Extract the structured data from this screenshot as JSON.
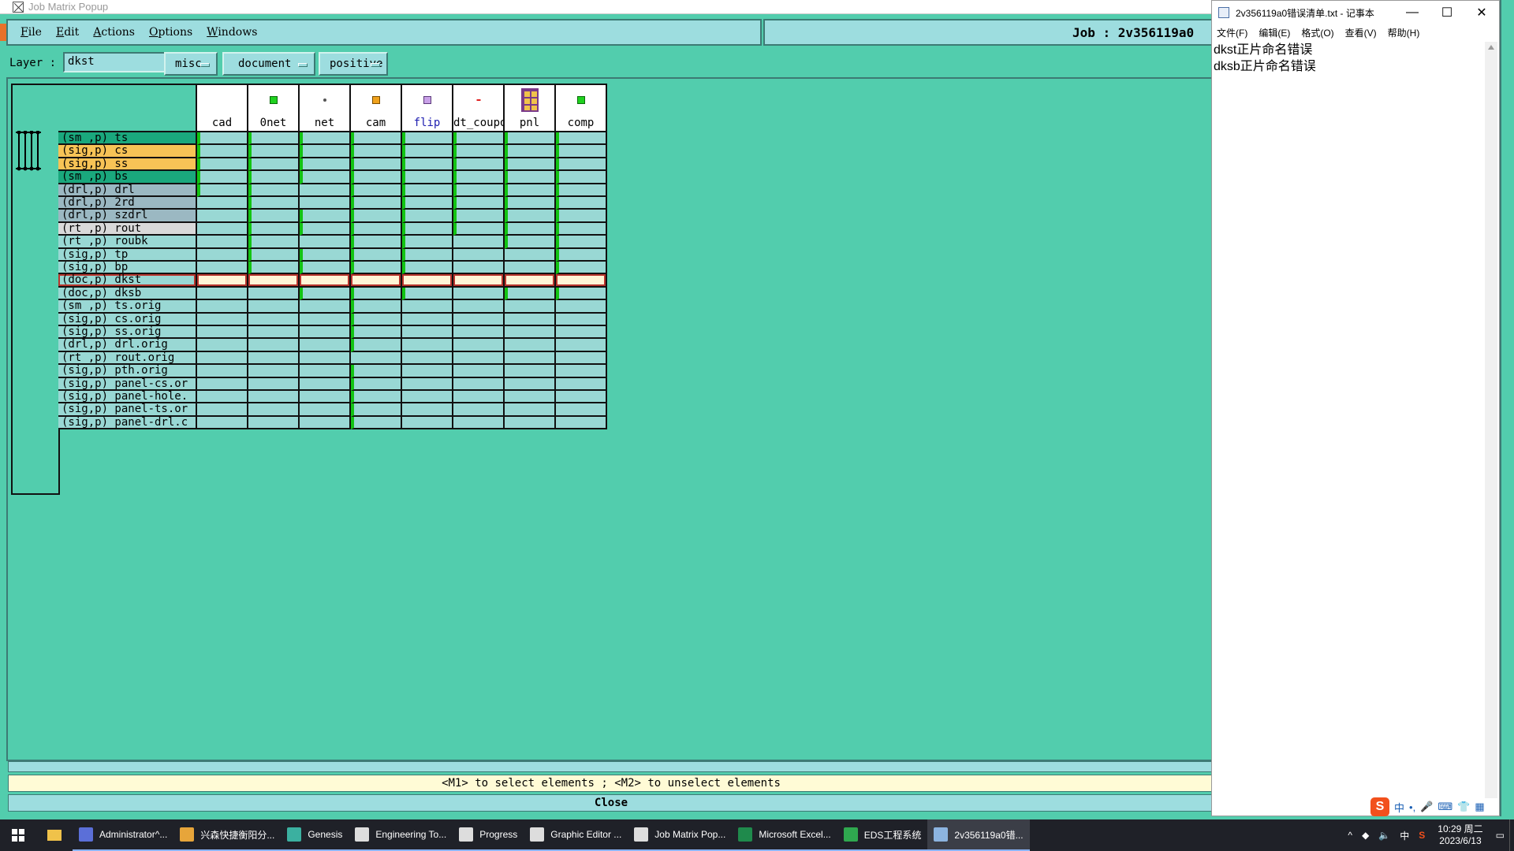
{
  "job_window": {
    "title": "Job Matrix Popup",
    "menus": [
      {
        "u": "F",
        "rest": "ile"
      },
      {
        "u": "E",
        "rest": "dit"
      },
      {
        "u": "A",
        "rest": "ctions"
      },
      {
        "u": "O",
        "rest": "ptions"
      },
      {
        "u": "W",
        "rest": "indows"
      }
    ],
    "job_label": "Job : 2v356119a0",
    "layer_label": "Layer :",
    "layer_value": "dkst",
    "combos": [
      "misc",
      "document",
      "positive"
    ],
    "columns": [
      {
        "label": "cad",
        "icon": "none",
        "color": "#000000"
      },
      {
        "label": "0net",
        "icon": "green-square",
        "color": "#000000"
      },
      {
        "label": "net",
        "icon": "dot",
        "color": "#000000"
      },
      {
        "label": "cam",
        "icon": "orange-square",
        "color": "#000000"
      },
      {
        "label": "flip",
        "icon": "purple-square",
        "color": "#1d1db0"
      },
      {
        "label": "dt_coupo",
        "icon": "red-dash",
        "color": "#000000"
      },
      {
        "label": "pnl",
        "icon": "panel-grid",
        "color": "#000000"
      },
      {
        "label": "comp",
        "icon": "green-square",
        "color": "#000000"
      }
    ],
    "rows": [
      {
        "label": "(sm ,p) ts",
        "bg": "#1aa87d"
      },
      {
        "label": "(sig,p) cs",
        "bg": "#f7c356"
      },
      {
        "label": "(sig,p) ss",
        "bg": "#f7c356"
      },
      {
        "label": "(sm ,p) bs",
        "bg": "#1aa87d"
      },
      {
        "label": "(drl,p) drl",
        "bg": "#9bb8c2"
      },
      {
        "label": "(drl,p) 2rd",
        "bg": "#9bb8c2"
      },
      {
        "label": "(drl,p) szdrl",
        "bg": "#9bb8c2"
      },
      {
        "label": "(rt ,p) rout",
        "bg": "#d9d9d9"
      },
      {
        "label": "(rt ,p) roubk",
        "bg": "#99d8d4"
      },
      {
        "label": "(sig,p) tp",
        "bg": "#99d8d4"
      },
      {
        "label": "(sig,p) bp",
        "bg": "#99d8d4"
      },
      {
        "label": "(doc,p) dkst",
        "bg": "#99d8d4"
      },
      {
        "label": "(doc,p) dksb",
        "bg": "#99d8d4"
      },
      {
        "label": "(sm ,p) ts.orig",
        "bg": "#99d8d4"
      },
      {
        "label": "(sig,p) cs.orig",
        "bg": "#99d8d4"
      },
      {
        "label": "(sig,p) ss.orig",
        "bg": "#99d8d4"
      },
      {
        "label": "(drl,p) drl.orig",
        "bg": "#99d8d4"
      },
      {
        "label": "(rt ,p) rout.orig",
        "bg": "#99d8d4"
      },
      {
        "label": "(sig,p) pth.orig",
        "bg": "#99d8d4"
      },
      {
        "label": "(sig,p) panel-cs.or",
        "bg": "#99d8d4"
      },
      {
        "label": "(sig,p) panel-hole.",
        "bg": "#99d8d4"
      },
      {
        "label": "(sig,p) panel-ts.or",
        "bg": "#99d8d4"
      },
      {
        "label": "(sig,p) panel-drl.c",
        "bg": "#99d8d4"
      }
    ],
    "flags": [
      [
        1,
        1,
        1,
        1,
        1,
        1,
        1,
        1
      ],
      [
        1,
        1,
        1,
        1,
        1,
        1,
        1,
        1
      ],
      [
        1,
        1,
        1,
        1,
        1,
        1,
        1,
        1
      ],
      [
        1,
        1,
        1,
        1,
        1,
        1,
        1,
        1
      ],
      [
        1,
        1,
        0,
        1,
        1,
        1,
        1,
        1
      ],
      [
        0,
        1,
        0,
        1,
        1,
        1,
        1,
        1
      ],
      [
        0,
        1,
        1,
        1,
        1,
        1,
        1,
        1
      ],
      [
        0,
        1,
        1,
        1,
        1,
        1,
        1,
        1
      ],
      [
        0,
        1,
        0,
        1,
        1,
        0,
        1,
        1
      ],
      [
        0,
        1,
        1,
        1,
        1,
        0,
        0,
        1
      ],
      [
        0,
        1,
        1,
        1,
        1,
        0,
        0,
        1
      ],
      [
        0,
        0,
        0,
        0,
        0,
        0,
        0,
        0
      ],
      [
        0,
        0,
        1,
        1,
        1,
        0,
        1,
        1
      ],
      [
        0,
        0,
        0,
        1,
        0,
        0,
        0,
        0
      ],
      [
        0,
        0,
        0,
        1,
        0,
        0,
        0,
        0
      ],
      [
        0,
        0,
        0,
        1,
        0,
        0,
        0,
        0
      ],
      [
        0,
        0,
        0,
        1,
        0,
        0,
        0,
        0
      ],
      [
        0,
        0,
        0,
        0,
        0,
        0,
        0,
        0
      ],
      [
        0,
        0,
        0,
        1,
        0,
        0,
        0,
        0
      ],
      [
        0,
        0,
        0,
        1,
        0,
        0,
        0,
        0
      ],
      [
        0,
        0,
        0,
        1,
        0,
        0,
        0,
        0
      ],
      [
        0,
        0,
        0,
        1,
        0,
        0,
        0,
        0
      ],
      [
        0,
        0,
        0,
        1,
        0,
        0,
        0,
        0
      ]
    ],
    "selected_row": 11,
    "hint": "<M1> to select elements ; <M2> to unselect elements",
    "close_label": "Close"
  },
  "notepad": {
    "title": "2v356119a0错误清单.txt - 记事本",
    "controls": [
      "—",
      "☐",
      "✕"
    ],
    "menus": [
      "文件(F)",
      "编辑(E)",
      "格式(O)",
      "查看(V)",
      "帮助(H)"
    ],
    "lines": [
      "dkst正片命名错误",
      "dksb正片命名错误"
    ]
  },
  "ime": {
    "lang": "中",
    "punct": "•,"
  },
  "taskbar": {
    "apps": [
      {
        "label": "Administrator^...",
        "color": "#5b6fd8",
        "active": false
      },
      {
        "label": "兴森快捷衡阳分...",
        "color": "#e7a53a",
        "active": false
      },
      {
        "label": "Genesis",
        "color": "#3bb0a0",
        "active": false
      },
      {
        "label": "Engineering To...",
        "color": "#dddddd",
        "active": false
      },
      {
        "label": "Progress",
        "color": "#dddddd",
        "active": false
      },
      {
        "label": "Graphic Editor ...",
        "color": "#dddddd",
        "active": false
      },
      {
        "label": "Job Matrix Pop...",
        "color": "#dddddd",
        "active": false
      },
      {
        "label": "Microsoft Excel...",
        "color": "#1f8a4c",
        "active": false
      },
      {
        "label": "EDS工程系统",
        "color": "#2fa84f",
        "active": false
      },
      {
        "label": "2v356119a0错...",
        "color": "#8cb4e0",
        "active": true
      }
    ],
    "tray": [
      "^",
      "中",
      "S"
    ],
    "time": "10:29 周二",
    "date": "2023/6/13"
  }
}
